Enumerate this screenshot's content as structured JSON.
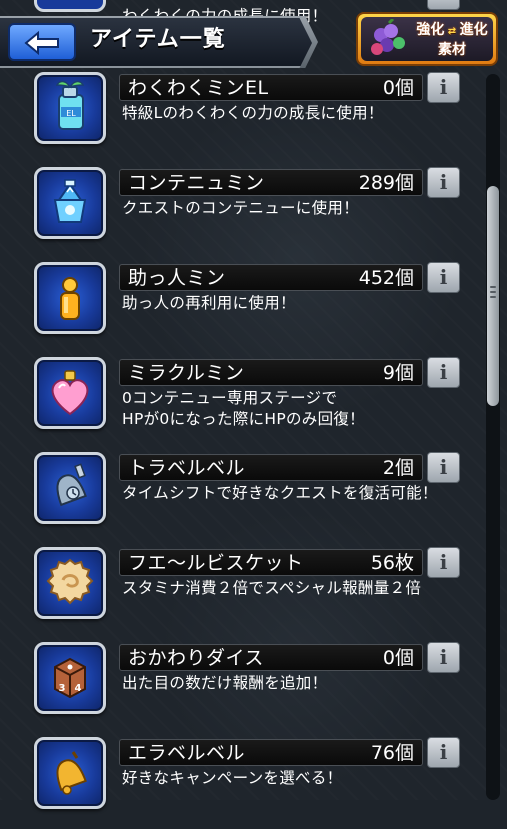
{
  "header": {
    "title": "アイテム一覧",
    "enhance_button": {
      "line1": "強化",
      "line2": "進化",
      "line3": "素材"
    }
  },
  "peek_item": {
    "description": "わくわくの力の成長に使用！"
  },
  "items": [
    {
      "name": "わくわくミンEL",
      "count": "0個",
      "description": "特級Lのわくわくの力の成長に使用！",
      "icon": "wakuwaku-min-el-bottle-icon"
    },
    {
      "name": "コンテニュミン",
      "count": "289個",
      "description": "クエストのコンテニューに使用！",
      "icon": "continue-min-icon"
    },
    {
      "name": "助っ人ミン",
      "count": "452個",
      "description": "助っ人の再利用に使用！",
      "icon": "helper-min-icon"
    },
    {
      "name": "ミラクルミン",
      "count": "9個",
      "description": "0コンテニュー専用ステージで\nHPが0になった際にHPのみ回復！",
      "icon": "miracle-min-heart-icon"
    },
    {
      "name": "トラベルベル",
      "count": "2個",
      "description": "タイムシフトで好きなクエストを復活可能！",
      "icon": "travel-bell-icon"
    },
    {
      "name": "フエ～ルビスケット",
      "count": "56枚",
      "description": "スタミナ消費２倍でスペシャル報酬量２倍",
      "icon": "biscuit-icon"
    },
    {
      "name": "おかわりダイス",
      "count": "0個",
      "description": "出た目の数だけ報酬を追加！",
      "icon": "dice-icon"
    },
    {
      "name": "エラベルベル",
      "count": "76個",
      "description": "好きなキャンペーンを選べる！",
      "icon": "erabel-bell-icon"
    }
  ],
  "colors": {
    "tile_blue": "#183a9a",
    "header_plate": "#1a2029",
    "enhance_orange": "#e07b12"
  }
}
